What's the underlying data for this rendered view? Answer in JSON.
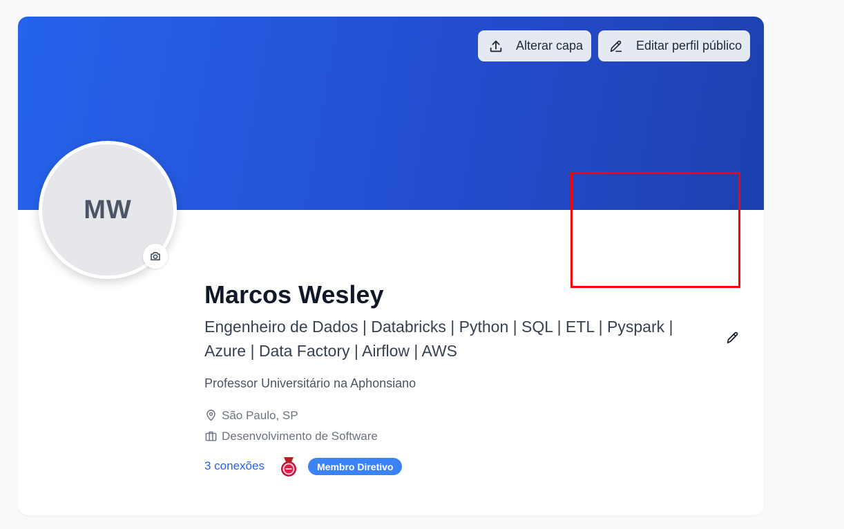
{
  "cover": {
    "change_cover_label": "Alterar capa",
    "edit_public_profile_label": "Editar perfil público",
    "gradient_start": "#2563eb",
    "gradient_end": "#1e40af",
    "change_cover_icon": "upload-icon",
    "edit_public_profile_icon": "pencil-icon"
  },
  "avatar": {
    "initials": "MW",
    "camera_icon": "camera-icon"
  },
  "profile": {
    "name": "Marcos Wesley",
    "headline": "Engenheiro de Dados | Databricks | Python | SQL | ETL | Pyspark | Azure | Data Factory | Airflow | AWS",
    "headline_edit_icon": "pencil-icon",
    "role": "Professor Universitário na Aphonsiano",
    "location": "São Paulo, SP",
    "location_icon": "map-pin-icon",
    "industry": "Desenvolvimento de Software",
    "industry_icon": "briefcase-icon",
    "connections": "3 conexões",
    "medal_icon": "medal-icon",
    "badge": "Membro Diretivo"
  },
  "colors": {
    "accent": "#2563eb",
    "badge_bg": "#3b82f6",
    "annotation": "#ff0000"
  }
}
